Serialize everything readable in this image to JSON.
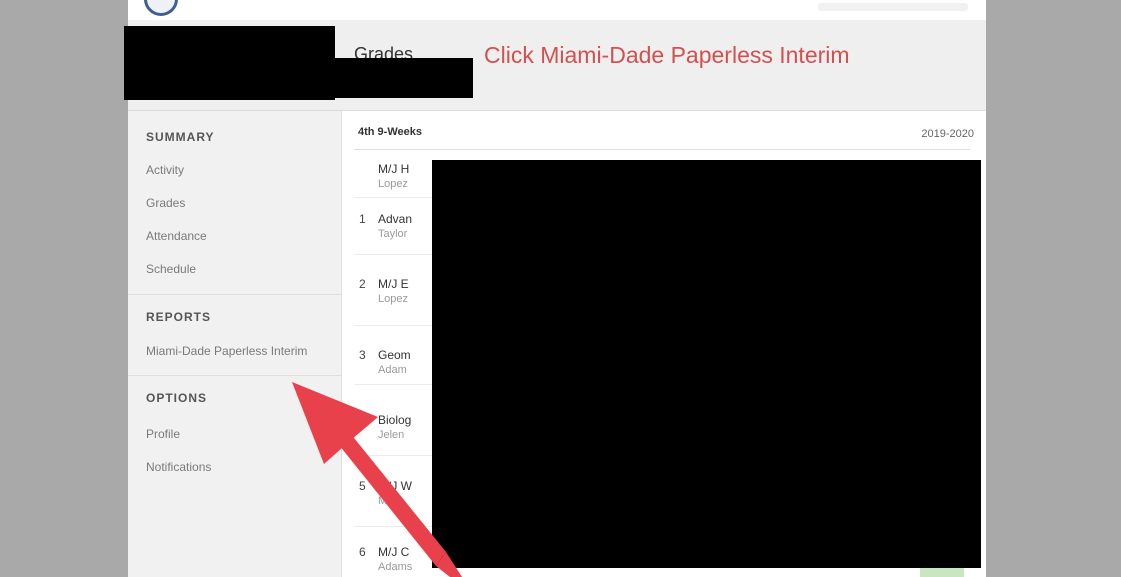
{
  "header": {
    "title": "Grades",
    "instruction": "Click Miami-Dade Paperless Interim"
  },
  "sidebar": {
    "summary_heading": "SUMMARY",
    "summary_items": [
      {
        "label": "Activity"
      },
      {
        "label": "Grades"
      },
      {
        "label": "Attendance"
      },
      {
        "label": "Schedule"
      }
    ],
    "reports_heading": "REPORTS",
    "reports_items": [
      {
        "label": "Miami-Dade Paperless Interim"
      }
    ],
    "options_heading": "OPTIONS",
    "options_items": [
      {
        "label": "Profile"
      },
      {
        "label": "Notifications"
      }
    ]
  },
  "grades": {
    "term": "4th 9-Weeks",
    "year": "2019-2020",
    "rows": [
      {
        "period": "",
        "course": "M/J H",
        "teacher": "Lopez"
      },
      {
        "period": "1",
        "course": "Advan",
        "teacher": "Taylor"
      },
      {
        "period": "2",
        "course": "M/J E",
        "teacher": "Lopez"
      },
      {
        "period": "3",
        "course": "Geom",
        "teacher": "Adam"
      },
      {
        "period": "",
        "course": "Biolog",
        "teacher": "Jelen"
      },
      {
        "period": "5",
        "course": "M/J W",
        "teacher": "Mor"
      },
      {
        "period": "6",
        "course": "M/J C",
        "teacher": "Adams"
      }
    ]
  },
  "colors": {
    "annotation": "#d4504f",
    "arrow": "#e8414b",
    "redaction": "#000000"
  },
  "icons": {
    "logo": "school-logo-icon",
    "annotation_arrow": "arrow-icon"
  }
}
